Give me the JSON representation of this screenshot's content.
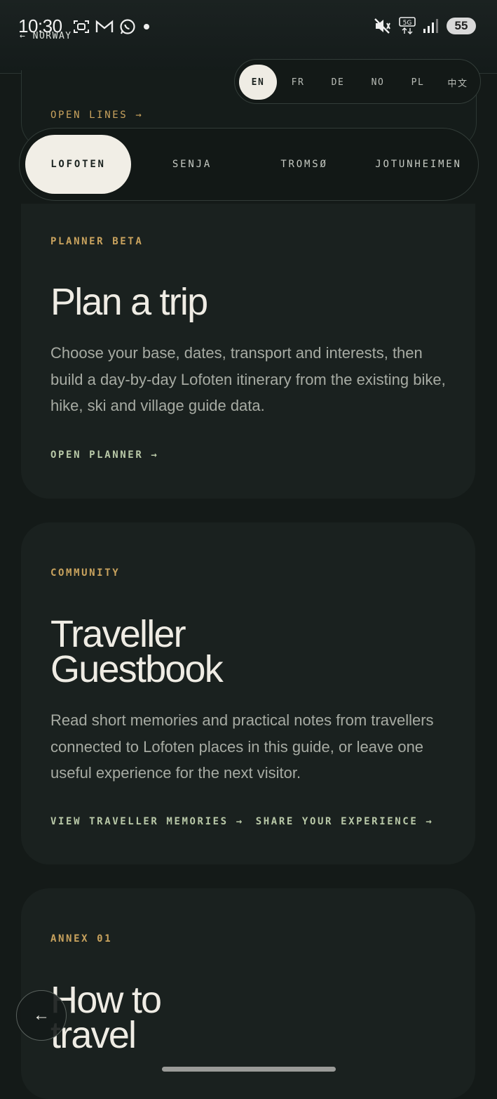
{
  "status_bar": {
    "time": "10:30",
    "battery": "55",
    "left_icons": [
      "screenshot-icon",
      "gmail-icon",
      "whatsapp-icon",
      "dot-icon"
    ],
    "right_icons": [
      "mute-icon",
      "5g-icon",
      "signal-icon"
    ]
  },
  "header": {
    "back_label": "← NORWAY"
  },
  "open_lines": {
    "link_label": "OPEN LINES →"
  },
  "languages": {
    "items": [
      "EN",
      "FR",
      "DE",
      "NO",
      "PL",
      "中文"
    ],
    "active": "EN"
  },
  "regions": {
    "items": [
      "LOFOTEN",
      "SENJA",
      "TROMSØ",
      "JOTUNHEIMEN"
    ],
    "active": "LOFOTEN"
  },
  "planner_card": {
    "eyebrow": "PLANNER BETA",
    "title": "Plan a trip",
    "body": "Choose your base, dates, transport and interests, then build a day-by-day Lofoten itinerary from the existing bike, hike, ski and village guide data.",
    "link": "OPEN PLANNER →"
  },
  "guestbook_card": {
    "eyebrow": "COMMUNITY",
    "title_line1": "Traveller",
    "title_line2": "Guestbook",
    "body": "Read short memories and practical notes from travellers connected to Lofoten places in this guide, or leave one useful experience for the next visitor.",
    "link_memories": "VIEW TRAVELLER MEMORIES →",
    "link_share": "SHARE YOUR EXPERIENCE →"
  },
  "annex_card": {
    "eyebrow": "ANNEX 01",
    "title_line1": "How to",
    "title_line2": "travel"
  },
  "floating_back": {
    "label": "←"
  },
  "colors": {
    "background": "#141a18",
    "card": "#1a211f",
    "accent_gold": "#c9a35e",
    "link_green": "#b9c9a8",
    "pill_active": "#efece4"
  }
}
